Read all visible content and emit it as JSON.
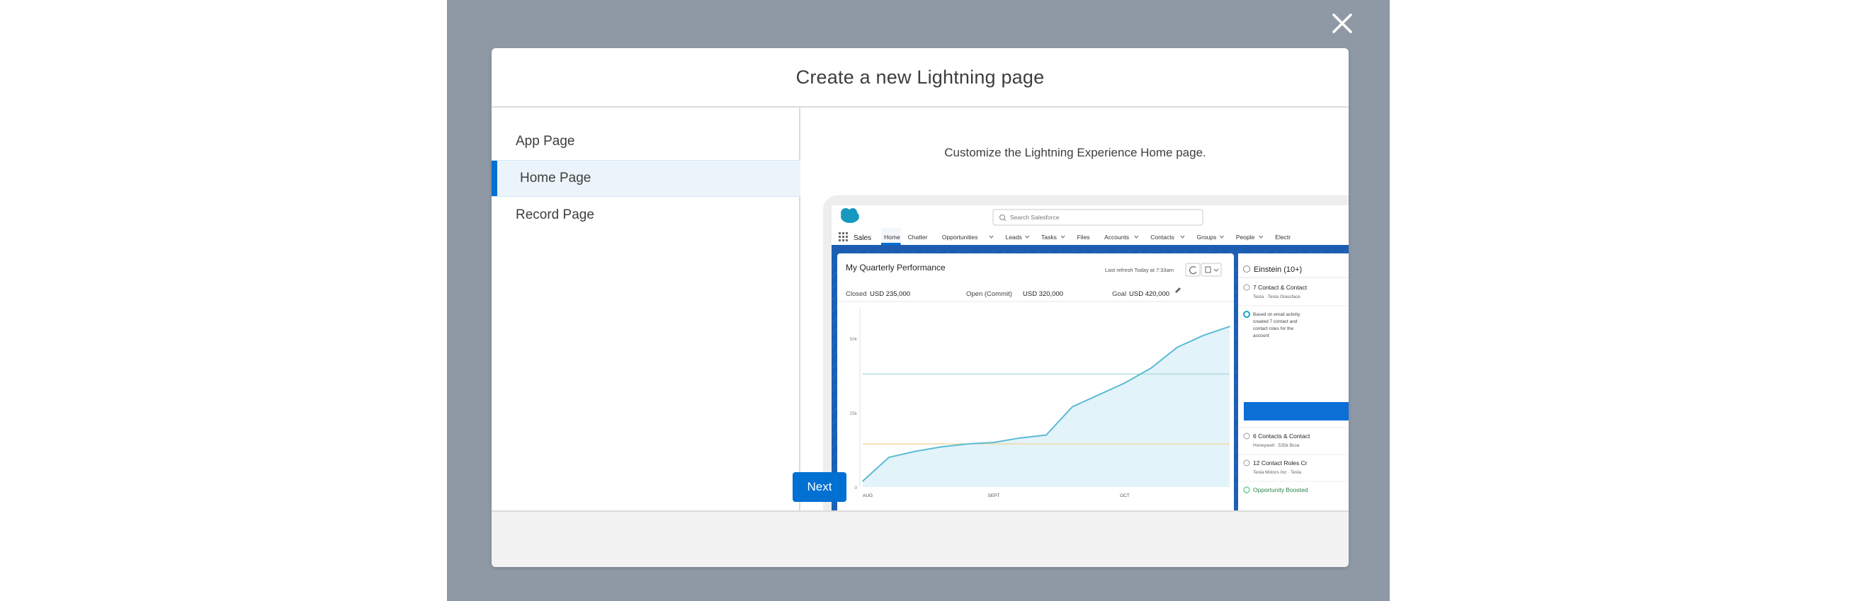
{
  "modal": {
    "title": "Create a new Lightning page",
    "close_icon": "close-icon",
    "next_label": "Next"
  },
  "page_types": [
    {
      "label": "App Page",
      "selected": false
    },
    {
      "label": "Home Page",
      "selected": true
    },
    {
      "label": "Record Page",
      "selected": false
    }
  ],
  "description": "Customize the Lightning Experience Home page.",
  "preview": {
    "search_placeholder": "Search Salesforce",
    "app_name": "Sales",
    "nav_items": [
      "Home",
      "Chatter",
      "Opportunities",
      "Leads",
      "Tasks",
      "Files",
      "Accounts",
      "Contacts",
      "Groups",
      "People",
      "Electr"
    ],
    "nav_dropdown_flags": [
      false,
      false,
      true,
      true,
      true,
      false,
      true,
      true,
      true,
      true,
      false
    ],
    "performance": {
      "title": "My Quarterly Performance",
      "refresh_text": "Last refresh Today at 7:33am",
      "closed_label": "Closed",
      "closed_value": "USD 235,000",
      "open_label": "Open (Commit)",
      "open_value": "USD 320,000",
      "goal_label": "Goal",
      "goal_value": "USD 420,000"
    },
    "chart_data": {
      "type": "area",
      "x_tick_labels": [
        "AUG",
        "SEPT",
        "OCT"
      ],
      "y_tick_labels": [
        "0",
        "25k",
        "50k"
      ],
      "ylim": [
        0,
        60
      ],
      "x": [
        0,
        1,
        2,
        3,
        4,
        5,
        6,
        7,
        8,
        9,
        10,
        11,
        12,
        13,
        14
      ],
      "values": [
        2,
        10,
        12,
        13.5,
        14.5,
        15,
        16.5,
        17.5,
        27,
        31,
        35,
        40,
        47,
        51,
        54
      ],
      "reference_lines": [
        {
          "value": 38,
          "color": "#a8dcd8"
        },
        {
          "value": 14.5,
          "color": "#f2d49b"
        }
      ],
      "line_color": "#5bbbd6",
      "fill_color": "#e3f3fa",
      "grid": false
    },
    "einstein": {
      "title": "Einstein (10+)",
      "items": [
        {
          "title": "7 Contact & Contact",
          "sub": "Tesla · Tesla Glassface"
        },
        {
          "title": "Based on email activity",
          "sub": "created 7 contact and"
        },
        {
          "title": "6 Contacts & Contact",
          "sub": "Honeywell · 535k Broa"
        },
        {
          "title": "12 Contact Roles Cr",
          "sub": "Tesla Motors Inc · Tesla"
        },
        {
          "title": "Opportunity Boosted",
          "sub": ""
        }
      ],
      "extra_lines": [
        "contact roles for the",
        "account"
      ]
    }
  },
  "colors": {
    "overlay": "#8f99a6",
    "brand": "#0070d2",
    "selected_bg": "#ebf4fb"
  }
}
